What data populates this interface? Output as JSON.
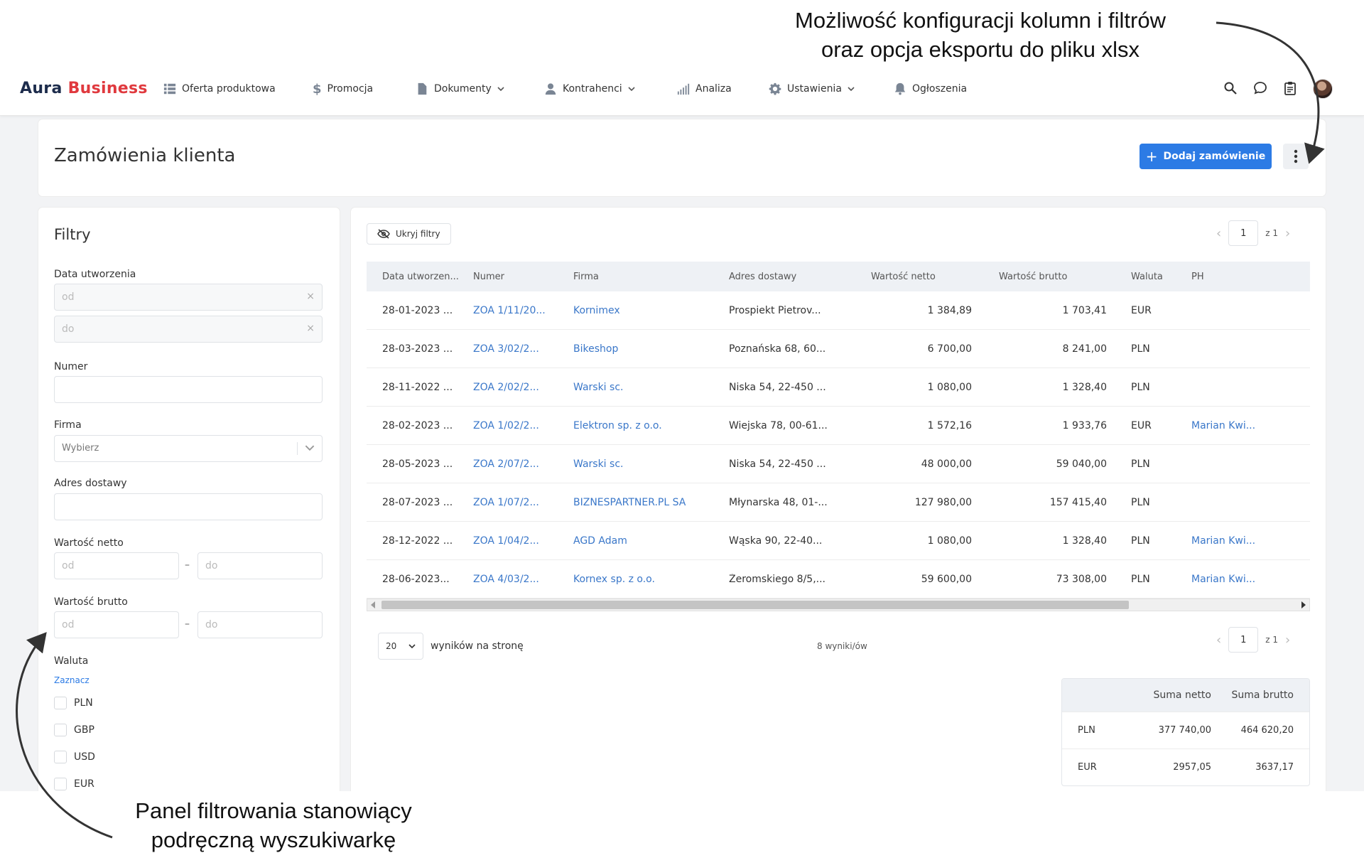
{
  "annotations": {
    "top_line1": "Możliwość konfiguracji kolumn i filtrów",
    "top_line2": "oraz opcja eksportu do pliku xlsx",
    "bottom_line1": "Panel filtrowania stanowiący",
    "bottom_line2": "podręczną wyszukiwarkę"
  },
  "app": {
    "logo_part1": "Aura",
    "logo_part2": "Business",
    "accent_color": "#2c7be5",
    "brand_red": "#e0393e"
  },
  "nav": {
    "items": [
      {
        "label": "Oferta produktowa",
        "icon": "list-icon"
      },
      {
        "label": "Promocja",
        "icon": "dollar-icon"
      },
      {
        "label": "Dokumenty",
        "icon": "document-icon"
      },
      {
        "label": "Kontrahenci",
        "icon": "user-icon"
      },
      {
        "label": "Analiza",
        "icon": "bar-chart-icon"
      },
      {
        "label": "Ustawienia",
        "icon": "gear-icon"
      },
      {
        "label": "Ogłoszenia",
        "icon": "bell-icon"
      }
    ]
  },
  "header": {
    "title": "Zamówienia klienta",
    "add_button": "Dodaj zamówienie"
  },
  "filters": {
    "title": "Filtry",
    "date_label": "Data utworzenia",
    "date_from_placeholder": "od",
    "date_to_placeholder": "do",
    "number_label": "Numer",
    "company_label": "Firma",
    "company_placeholder": "Wybierz",
    "address_label": "Adres dostawy",
    "net_label": "Wartość netto",
    "net_from": "od",
    "net_to": "do",
    "gross_label": "Wartość brutto",
    "gross_from": "od",
    "gross_to": "do",
    "currency_label": "Waluta",
    "select_all": "Zaznacz",
    "currencies": [
      "PLN",
      "GBP",
      "USD",
      "EUR"
    ],
    "dash": "–"
  },
  "table": {
    "hide_filters": "Ukryj filtry",
    "page": "1",
    "page_of": "z 1",
    "columns": [
      "Data utworzen...",
      "Numer",
      "Firma",
      "Adres dostawy",
      "Wartość netto",
      "Wartość brutto",
      "Waluta",
      "PH"
    ],
    "rows": [
      {
        "date": "28-01-2023 ...",
        "number": "ZOA 1/11/20...",
        "company": "Kornimex",
        "address": "Prospiekt Pietrov...",
        "net": "1 384,89",
        "gross": "1 703,41",
        "currency": "EUR",
        "ph": ""
      },
      {
        "date": "28-03-2023 ...",
        "number": "ZOA 3/02/2...",
        "company": "Bikeshop",
        "address": "Poznańska 68, 60...",
        "net": "6 700,00",
        "gross": "8 241,00",
        "currency": "PLN",
        "ph": ""
      },
      {
        "date": "28-11-2022 ...",
        "number": "ZOA 2/02/2...",
        "company": "Warski sc.",
        "address": "Niska 54, 22-450 ...",
        "net": "1 080,00",
        "gross": "1 328,40",
        "currency": "PLN",
        "ph": ""
      },
      {
        "date": "28-02-2023 ...",
        "number": "ZOA 1/02/2...",
        "company": "Elektron sp. z o.o.",
        "address": "Wiejska 78, 00-61...",
        "net": "1 572,16",
        "gross": "1 933,76",
        "currency": "EUR",
        "ph": "Marian Kwi..."
      },
      {
        "date": "28-05-2023 ...",
        "number": "ZOA 2/07/2...",
        "company": "Warski sc.",
        "address": "Niska 54, 22-450 ...",
        "net": "48 000,00",
        "gross": "59 040,00",
        "currency": "PLN",
        "ph": ""
      },
      {
        "date": "28-07-2023 ...",
        "number": "ZOA 1/07/2...",
        "company": "BIZNESPARTNER.PL SA",
        "address": "Młynarska 48, 01-...",
        "net": "127 980,00",
        "gross": "157 415,40",
        "currency": "PLN",
        "ph": ""
      },
      {
        "date": "28-12-2022 ...",
        "number": "ZOA 1/04/2...",
        "company": "AGD Adam",
        "address": "Wąska 90, 22-40...",
        "net": "1 080,00",
        "gross": "1 328,40",
        "currency": "PLN",
        "ph": "Marian Kwi..."
      },
      {
        "date": "28-06-2023...",
        "number": "ZOA 4/03/2...",
        "company": "Kornex sp. z o.o.",
        "address": "Żeromskiego 8/5,...",
        "net": "59 600,00",
        "gross": "73 308,00",
        "currency": "PLN",
        "ph": "Marian Kwi..."
      }
    ],
    "per_page_value": "20",
    "per_page_label": "wyników na stronę",
    "result_count": "8 wyniki/ów"
  },
  "summary": {
    "col_net": "Suma netto",
    "col_gross": "Suma brutto",
    "rows": [
      {
        "currency": "PLN",
        "net": "377 740,00",
        "gross": "464 620,20"
      },
      {
        "currency": "EUR",
        "net": "2957,05",
        "gross": "3637,17"
      }
    ]
  }
}
